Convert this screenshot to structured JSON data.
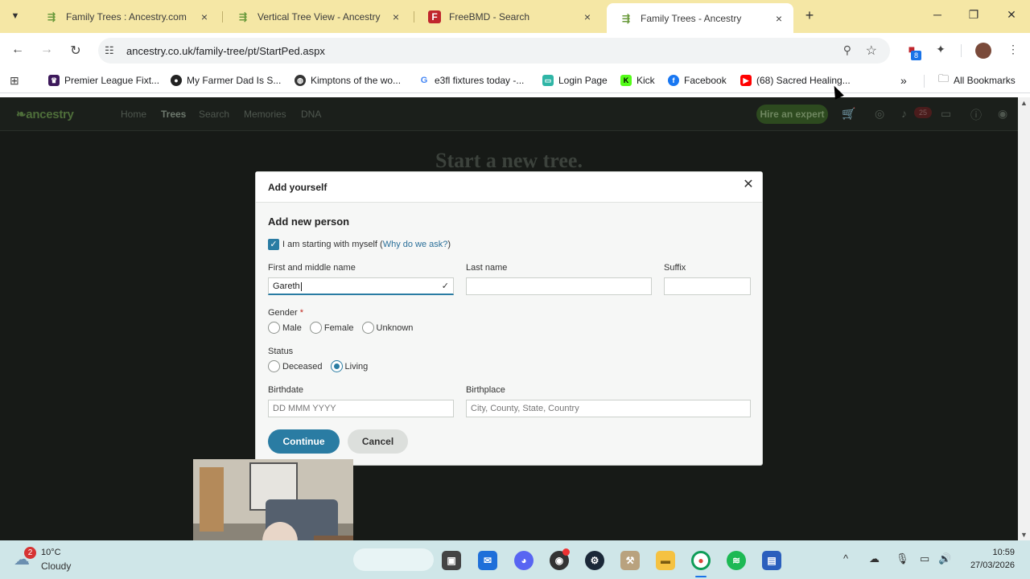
{
  "browser": {
    "tabs": [
      {
        "title": "Family Trees : Ancestry.com",
        "icon": "ancestry-leaf-icon"
      },
      {
        "title": "Vertical Tree View - Ancestry",
        "icon": "ancestry-leaf-icon"
      },
      {
        "title": "FreeBMD - Search",
        "icon": "freebmd-icon"
      },
      {
        "title": "Family Trees - Ancestry",
        "icon": "ancestry-leaf-icon",
        "active": true
      }
    ],
    "url": "ancestry.co.uk/family-tree/pt/StartPed.aspx",
    "extension_badge": "8",
    "bookmarks": [
      {
        "label": "Premier League Fixt...",
        "color": "#3d195b"
      },
      {
        "label": "My Farmer Dad Is S...",
        "color": "#222222"
      },
      {
        "label": "Kimptons of the wo...",
        "color": "#333333"
      },
      {
        "label": "e3fl fixtures today -...",
        "color": "#4285f4"
      },
      {
        "label": "Login Page",
        "color": "#2fb5a6"
      },
      {
        "label": "Kick",
        "color": "#53fc18"
      },
      {
        "label": "Facebook",
        "color": "#1877f2"
      },
      {
        "label": "(68) Sacred Healing...",
        "color": "#ff0000"
      }
    ],
    "all_bookmarks": "All Bookmarks"
  },
  "ancestry": {
    "logo": "ancestry",
    "nav": [
      "Home",
      "Trees",
      "Search",
      "Memories",
      "DNA"
    ],
    "active_nav": "Trees",
    "hire_button": "Hire an expert",
    "notification_badge": "25",
    "background_title": "Start a new tree."
  },
  "modal": {
    "title": "Add yourself",
    "section_title": "Add new person",
    "checkbox_label": "I am starting with myself (",
    "why_link": "Why do we ask?",
    "checkbox_close": ")",
    "first_name_label": "First and middle name",
    "first_name_value": "Gareth",
    "last_name_label": "Last name",
    "last_name_value": "",
    "suffix_label": "Suffix",
    "suffix_value": "",
    "gender_label": "Gender",
    "required_mark": "*",
    "gender_options": [
      "Male",
      "Female",
      "Unknown"
    ],
    "status_label": "Status",
    "status_options": [
      "Deceased",
      "Living"
    ],
    "status_selected": "Living",
    "birthdate_label": "Birthdate",
    "birthdate_placeholder": "DD MMM YYYY",
    "birthplace_label": "Birthplace",
    "birthplace_placeholder": "City, County, State, Country",
    "continue_label": "Continue",
    "cancel_label": "Cancel"
  },
  "taskbar": {
    "weather_badge": "2",
    "temperature": "10°C",
    "weather": "Cloudy",
    "time": "10:59",
    "date": "27/03/2026"
  },
  "colors": {
    "tabbar": "#f5e7a5",
    "primary_blue": "#2a7ca3",
    "page_dark": "#171a17"
  }
}
